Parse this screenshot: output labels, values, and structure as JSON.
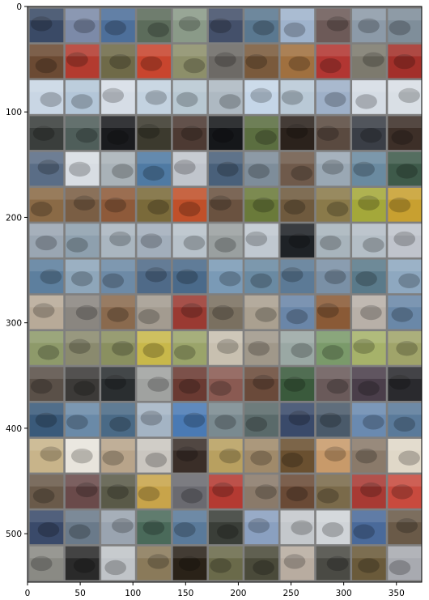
{
  "figure": {
    "description_free": true,
    "grid": {
      "rows": 16,
      "cols": 11,
      "frame_color": "#7f7f7f",
      "tile_palettes": [
        [
          "#3a4a66",
          "#7c8aa8",
          "#4d6f9a",
          "#5c6c5b",
          "#8a9a88",
          "#44506a",
          "#5a7890",
          "#9fb3cc",
          "#6d5a58",
          "#8c9aa8",
          "#7f8e9a"
        ],
        [
          "#6b4a33",
          "#b33b2f",
          "#6f6a48",
          "#c8452e",
          "#8d8f6a",
          "#6d6a66",
          "#7a5a3c",
          "#a0703f",
          "#b23632",
          "#7d7a6e",
          "#a3302a"
        ],
        [
          "#c9d6e4",
          "#b3c6d8",
          "#d6dde6",
          "#c3d2e0",
          "#b8c8d2",
          "#aeb9c2",
          "#c5d6e8",
          "#b9c9d6",
          "#9eb0c8",
          "#d5dce4",
          "#d9dfe5"
        ],
        [
          "#3a3e3c",
          "#4f5e5a",
          "#1a1b1e",
          "#3c3a2e",
          "#4d3a33",
          "#15171a",
          "#5b6e40",
          "#2b221c",
          "#5a4a40",
          "#3a3e46",
          "#3d2f28"
        ],
        [
          "#5a6d86",
          "#d8dde3",
          "#a9b2b8",
          "#4f7aa3",
          "#c0c5cc",
          "#49607a",
          "#7e8d9a",
          "#6f5a4b",
          "#9aa8b4",
          "#6a8aa0",
          "#3e5a4a"
        ],
        [
          "#8a6a46",
          "#7a5e44",
          "#8e5a3a",
          "#7a6a3a",
          "#c0502a",
          "#6a5240",
          "#6a7a3a",
          "#6f5a3e",
          "#8a7a4a",
          "#a4a83a",
          "#c8a030"
        ],
        [
          "#9aa6b2",
          "#8ea0ae",
          "#aab6c0",
          "#a2aebb",
          "#b8c2ca",
          "#9aa0a0",
          "#c0c8d0",
          "#1e2226",
          "#a8b4bc",
          "#b4bec6",
          "#c0c4cc"
        ],
        [
          "#5d7f9e",
          "#8ea6ba",
          "#6d8aa6",
          "#4f6a88",
          "#4a6a8a",
          "#7a9ab6",
          "#6a8aa2",
          "#5c7a96",
          "#7a90a6",
          "#5a7a8a",
          "#8ea8c0"
        ],
        [
          "#b8aa98",
          "#8a8680",
          "#8a6a4e",
          "#a39b90",
          "#9a3a32",
          "#7a7060",
          "#aaa090",
          "#6a86a8",
          "#8a5a36",
          "#b8b0a8",
          "#6a88a8"
        ],
        [
          "#8e9a6a",
          "#8a8a6e",
          "#8a9060",
          "#c8b84a",
          "#9aa46a",
          "#c8c0b0",
          "#a0988a",
          "#9aa8a4",
          "#7a9a6a",
          "#a6b26a",
          "#a0a46a"
        ],
        [
          "#5a5048",
          "#3c3a38",
          "#2a2e30",
          "#a0a2a0",
          "#6a3a32",
          "#8a5a52",
          "#6a4a3a",
          "#3a5a3c",
          "#6a5a5a",
          "#4a3e4a",
          "#2a2a2e"
        ],
        [
          "#3a5a7a",
          "#6a8aa8",
          "#4a6a86",
          "#a4b4c4",
          "#4a7ab4",
          "#7a8a90",
          "#5a6a6a",
          "#3a4a6a",
          "#4a5a6a",
          "#6a8ab0",
          "#5a7a9a"
        ],
        [
          "#c8b48a",
          "#e8e4dc",
          "#b8a48a",
          "#cac6c0",
          "#3a2e28",
          "#b8a060",
          "#a08a6a",
          "#6a5030",
          "#c89a6a",
          "#8a7a6a",
          "#e0d8c8"
        ],
        [
          "#6a5a4a",
          "#6a4a4a",
          "#5a5a48",
          "#c8a44a",
          "#6a6a70",
          "#b43a32",
          "#8a7a6a",
          "#6a4a36",
          "#7a6a4a",
          "#a83a34",
          "#c84a3e"
        ],
        [
          "#3a4a6a",
          "#6a7a8a",
          "#9aa4b0",
          "#4a6a5a",
          "#5a7a9a",
          "#3a3e38",
          "#8aa0c0",
          "#c4c8cc",
          "#d0d4d8",
          "#4a6a9a",
          "#6a5a48"
        ],
        [
          "#8a8a84",
          "#2a2a2a",
          "#c0c4c8",
          "#8a7a5a",
          "#2a2218",
          "#6a6a4a",
          "#4a4a3a",
          "#b8aca0",
          "#4a4a44",
          "#6a5a3a",
          "#a8aab0"
        ]
      ]
    },
    "x_axis": {
      "range": [
        0,
        374
      ],
      "ticks": [
        {
          "value": 0,
          "label": "0"
        },
        {
          "value": 50,
          "label": "50"
        },
        {
          "value": 100,
          "label": "100"
        },
        {
          "value": 150,
          "label": "150"
        },
        {
          "value": 200,
          "label": "200"
        },
        {
          "value": 250,
          "label": "250"
        },
        {
          "value": 300,
          "label": "300"
        },
        {
          "value": 350,
          "label": "350"
        }
      ]
    },
    "y_axis": {
      "range": [
        0,
        546
      ],
      "inverted": true,
      "ticks": [
        {
          "value": 0,
          "label": "0"
        },
        {
          "value": 100,
          "label": "100"
        },
        {
          "value": 200,
          "label": "200"
        },
        {
          "value": 300,
          "label": "300"
        },
        {
          "value": 400,
          "label": "400"
        },
        {
          "value": 500,
          "label": "500"
        }
      ]
    }
  }
}
